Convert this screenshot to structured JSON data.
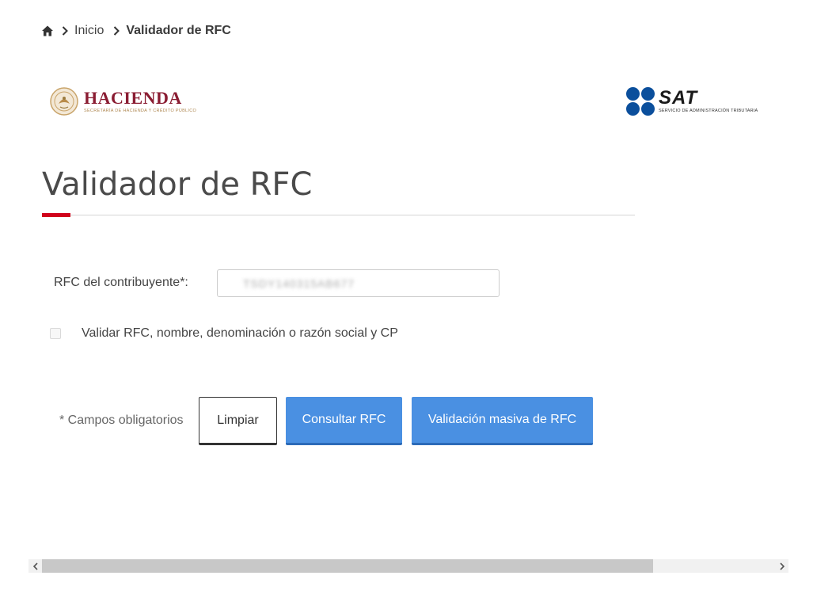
{
  "breadcrumb": {
    "home_icon": "home-icon",
    "items": [
      "Inicio",
      "Validador de RFC"
    ]
  },
  "logos": {
    "hacienda": {
      "name": "HACIENDA",
      "subtitle": "SECRETARÍA DE HACIENDA Y CRÉDITO PÚBLICO"
    },
    "sat": {
      "name": "SAT",
      "subtitle": "SERVICIO DE ADMINISTRACIÓN TRIBUTARIA"
    }
  },
  "page": {
    "title": "Validador de RFC"
  },
  "form": {
    "rfc_label": "RFC del contribuyente*:",
    "rfc_value": "TSDY140315AB677",
    "validate_checkbox_label": "Validar RFC, nombre, denominación o razón social y CP",
    "validate_checked": false,
    "required_note": "* Campos obligatorios",
    "clear_label": "Limpiar",
    "consult_label": "Consultar RFC",
    "bulk_label": "Validación masiva de RFC"
  },
  "colors": {
    "primary_button": "#4a90e2",
    "accent_red": "#d0021b",
    "hacienda_red": "#8a1c32",
    "sat_blue": "#0b4f9c"
  }
}
